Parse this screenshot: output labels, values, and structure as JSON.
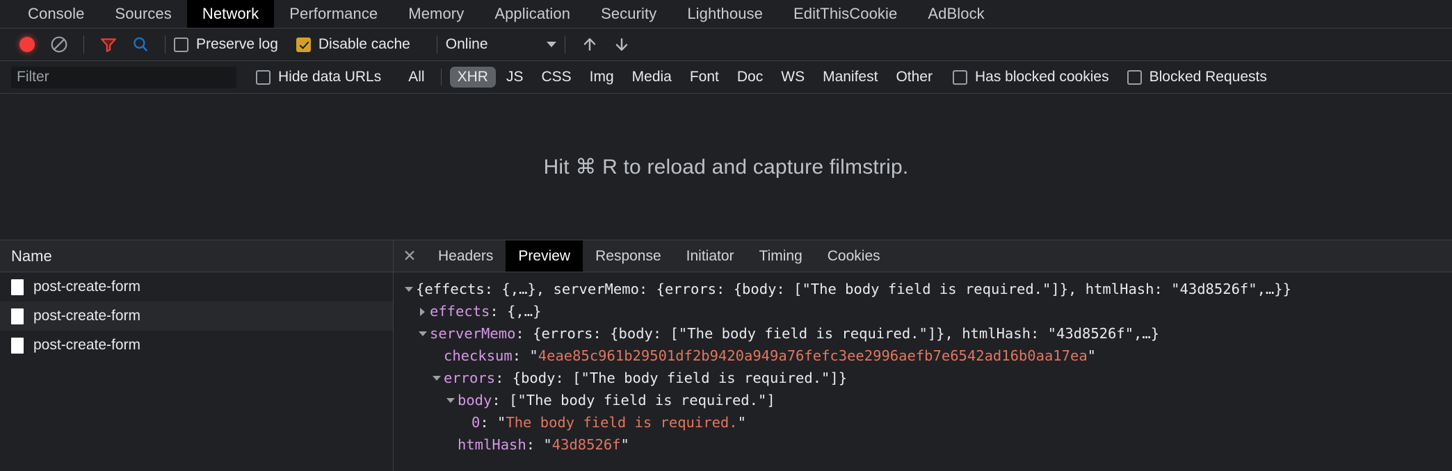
{
  "devtools_tabs": [
    {
      "label": "Console",
      "active": false
    },
    {
      "label": "Sources",
      "active": false
    },
    {
      "label": "Network",
      "active": true
    },
    {
      "label": "Performance",
      "active": false
    },
    {
      "label": "Memory",
      "active": false
    },
    {
      "label": "Application",
      "active": false
    },
    {
      "label": "Security",
      "active": false
    },
    {
      "label": "Lighthouse",
      "active": false
    },
    {
      "label": "EditThisCookie",
      "active": false
    },
    {
      "label": "AdBlock",
      "active": false
    }
  ],
  "toolbar": {
    "record_icon": "record-dot-icon",
    "clear_icon": "clear-circle-slash-icon",
    "filter_icon": "filter-funnel-icon",
    "search_icon": "search-magnifier-icon",
    "preserve_log_label": "Preserve log",
    "preserve_log_checked": false,
    "disable_cache_label": "Disable cache",
    "disable_cache_checked": true,
    "throttle_value": "Online",
    "import_icon": "upload-arrow-icon",
    "export_icon": "download-arrow-icon"
  },
  "filterbar": {
    "filter_placeholder": "Filter",
    "filter_value": "",
    "hide_data_urls_label": "Hide data URLs",
    "hide_data_urls_checked": false,
    "types": [
      {
        "label": "All",
        "active": false
      },
      {
        "label": "XHR",
        "active": true
      },
      {
        "label": "JS",
        "active": false
      },
      {
        "label": "CSS",
        "active": false
      },
      {
        "label": "Img",
        "active": false
      },
      {
        "label": "Media",
        "active": false
      },
      {
        "label": "Font",
        "active": false
      },
      {
        "label": "Doc",
        "active": false
      },
      {
        "label": "WS",
        "active": false
      },
      {
        "label": "Manifest",
        "active": false
      },
      {
        "label": "Other",
        "active": false
      }
    ],
    "has_blocked_cookies_label": "Has blocked cookies",
    "has_blocked_cookies_checked": false,
    "blocked_requests_label": "Blocked Requests",
    "blocked_requests_checked": false
  },
  "filmstrip": {
    "message": "Hit ⌘ R to reload and capture filmstrip."
  },
  "request_list": {
    "column_header": "Name",
    "rows": [
      {
        "name": "post-create-form"
      },
      {
        "name": "post-create-form"
      },
      {
        "name": "post-create-form"
      }
    ]
  },
  "detail": {
    "close_icon": "close-icon",
    "tabs": [
      {
        "label": "Headers",
        "active": false
      },
      {
        "label": "Preview",
        "active": true
      },
      {
        "label": "Response",
        "active": false
      },
      {
        "label": "Initiator",
        "active": false
      },
      {
        "label": "Timing",
        "active": false
      },
      {
        "label": "Cookies",
        "active": false
      }
    ],
    "preview_lines": [
      {
        "indent": 0,
        "arrow": "down",
        "segments": [
          {
            "t": "{",
            "c": "p"
          },
          {
            "t": "effects",
            "c": "p"
          },
          {
            "t": ": {,…}, ",
            "c": "p"
          },
          {
            "t": "serverMemo",
            "c": "p"
          },
          {
            "t": ": {",
            "c": "p"
          },
          {
            "t": "errors",
            "c": "p"
          },
          {
            "t": ": {",
            "c": "p"
          },
          {
            "t": "body",
            "c": "p"
          },
          {
            "t": ": [\"The body field is required.\"]}, ",
            "c": "p"
          },
          {
            "t": "htmlHash",
            "c": "p"
          },
          {
            "t": ": \"43d8526f\",…}}",
            "c": "p"
          }
        ]
      },
      {
        "indent": 1,
        "arrow": "right",
        "segments": [
          {
            "t": "effects",
            "c": "k"
          },
          {
            "t": ": {,…}",
            "c": "p"
          }
        ]
      },
      {
        "indent": 1,
        "arrow": "down",
        "segments": [
          {
            "t": "serverMemo",
            "c": "k"
          },
          {
            "t": ": {errors: {body: [\"The body field is required.\"]}, htmlHash: \"43d8526f\",…}",
            "c": "p"
          }
        ]
      },
      {
        "indent": 2,
        "arrow": "none",
        "segments": [
          {
            "t": "checksum",
            "c": "k"
          },
          {
            "t": ": \"",
            "c": "p"
          },
          {
            "t": "4eae85c961b29501df2b9420a949a76fefc3ee2996aefb7e6542ad16b0aa17ea",
            "c": "s"
          },
          {
            "t": "\"",
            "c": "p"
          }
        ]
      },
      {
        "indent": 2,
        "arrow": "down",
        "segments": [
          {
            "t": "errors",
            "c": "k"
          },
          {
            "t": ": {body: [\"The body field is required.\"]}",
            "c": "p"
          }
        ]
      },
      {
        "indent": 3,
        "arrow": "down",
        "segments": [
          {
            "t": "body",
            "c": "k"
          },
          {
            "t": ": [\"The body field is required.\"]",
            "c": "p"
          }
        ]
      },
      {
        "indent": 4,
        "arrow": "none",
        "segments": [
          {
            "t": "0",
            "c": "k"
          },
          {
            "t": ": \"",
            "c": "p"
          },
          {
            "t": "The body field is required.",
            "c": "s"
          },
          {
            "t": "\"",
            "c": "p"
          }
        ]
      },
      {
        "indent": 3,
        "arrow": "none",
        "segments": [
          {
            "t": "htmlHash",
            "c": "k"
          },
          {
            "t": ": \"",
            "c": "p"
          },
          {
            "t": "43d8526f",
            "c": "s"
          },
          {
            "t": "\"",
            "c": "p"
          }
        ]
      }
    ]
  },
  "colors": {
    "background": "#202124",
    "active_tab_bg": "#000000",
    "record_red": "#f43b3b",
    "filter_red": "#e2443b",
    "search_blue": "#1a73c8",
    "checkbox_amber": "#d3a029",
    "json_key": "#d698e8",
    "json_string": "#e2765f",
    "xhr_pill": "#5f6368"
  }
}
